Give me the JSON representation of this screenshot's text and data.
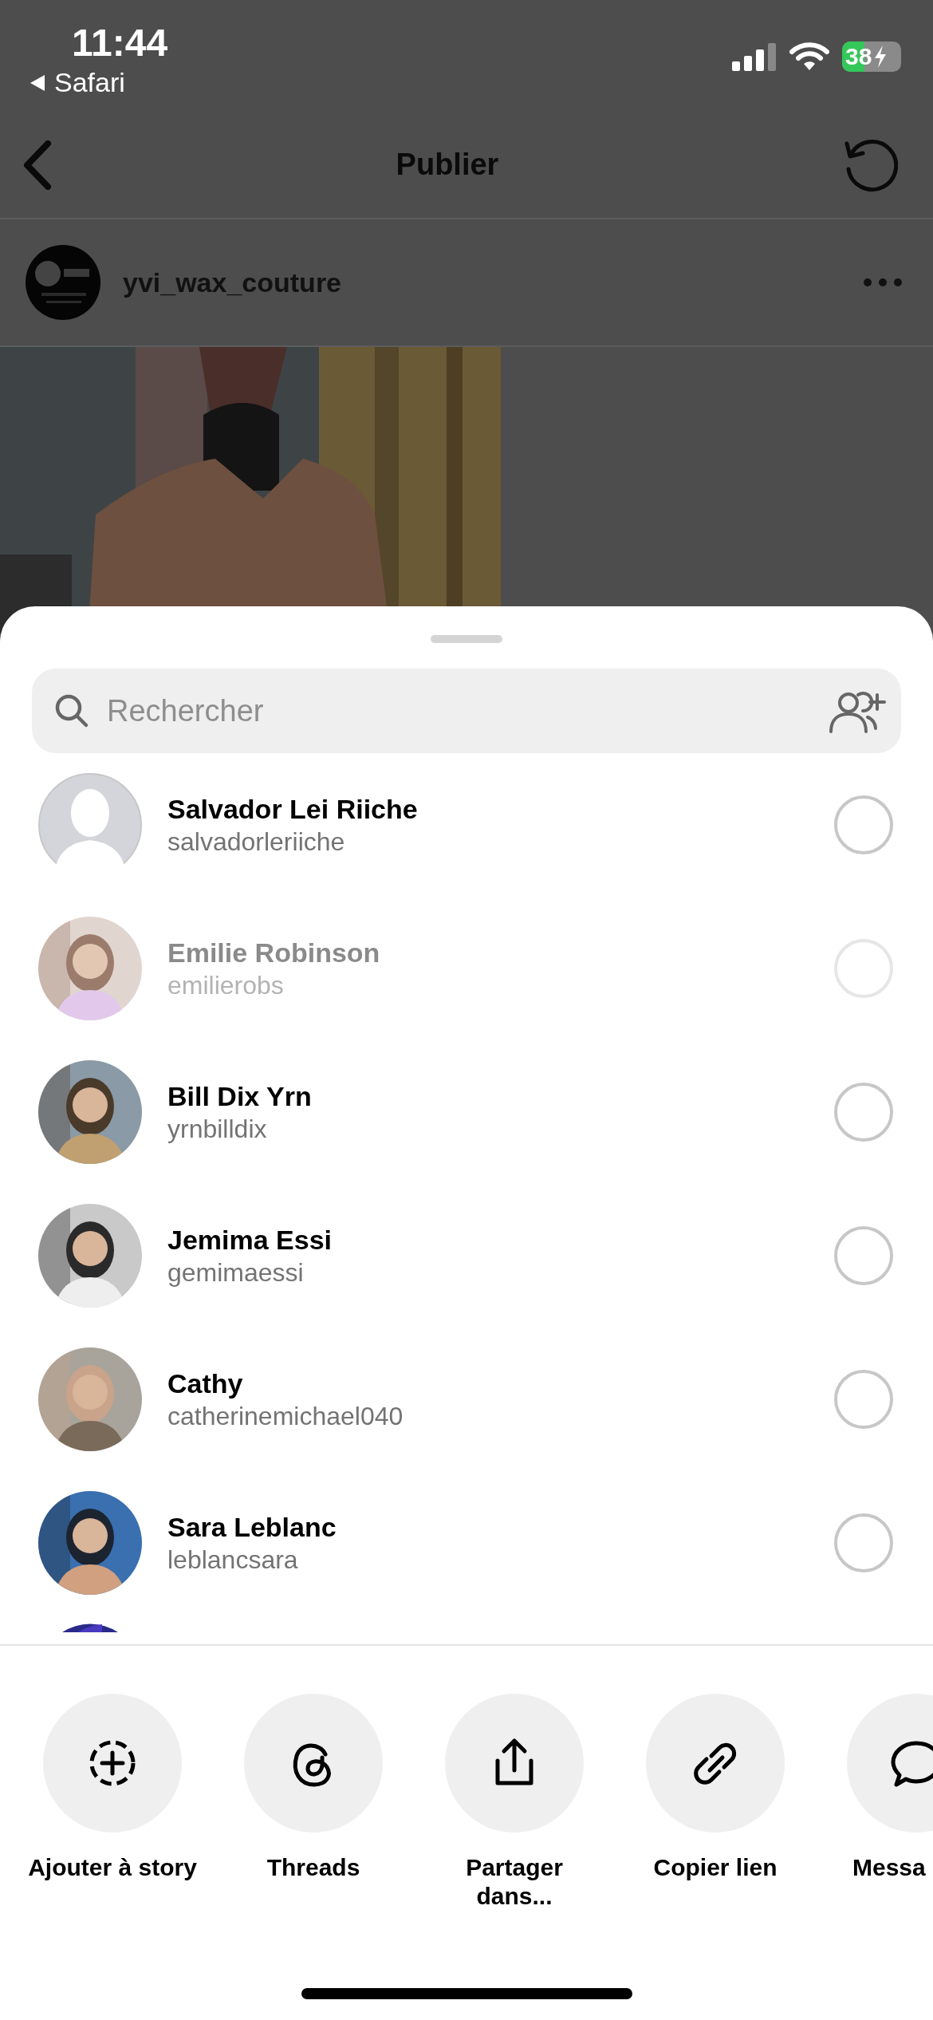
{
  "status_bar": {
    "time": "11:44",
    "back_label": "Safari",
    "battery": "38"
  },
  "nav": {
    "title": "Publier"
  },
  "post": {
    "username": "yvi_wax_couture"
  },
  "share_sheet": {
    "search": {
      "placeholder": "Rechercher"
    },
    "contacts": [
      {
        "name": "Salvador Lei Riiche",
        "username": "salvadorleriiche",
        "kind": "placeholder",
        "disabled": false,
        "selected": false
      },
      {
        "name": "Emilie Robinson",
        "username": "emilierobs",
        "kind": "picture",
        "disabled": true,
        "selected": false
      },
      {
        "name": "Bill Dix Yrn",
        "username": "yrnbilldix",
        "kind": "picture",
        "disabled": false,
        "selected": false
      },
      {
        "name": "Jemima Essi",
        "username": "gemimaessi",
        "kind": "picture",
        "disabled": false,
        "selected": false
      },
      {
        "name": "Cathy",
        "username": "catherinemichael040",
        "kind": "picture",
        "disabled": false,
        "selected": false
      },
      {
        "name": "Sara Leblanc",
        "username": "leblancsara",
        "kind": "picture",
        "disabled": false,
        "selected": false
      }
    ],
    "actions": [
      {
        "label": "Ajouter à story",
        "kind": "story"
      },
      {
        "label": "Threads",
        "kind": "threads"
      },
      {
        "label": "Partager dans...",
        "kind": "share"
      },
      {
        "label": "Copier lien",
        "kind": "link"
      },
      {
        "label": "Messa",
        "kind": "message"
      }
    ]
  }
}
